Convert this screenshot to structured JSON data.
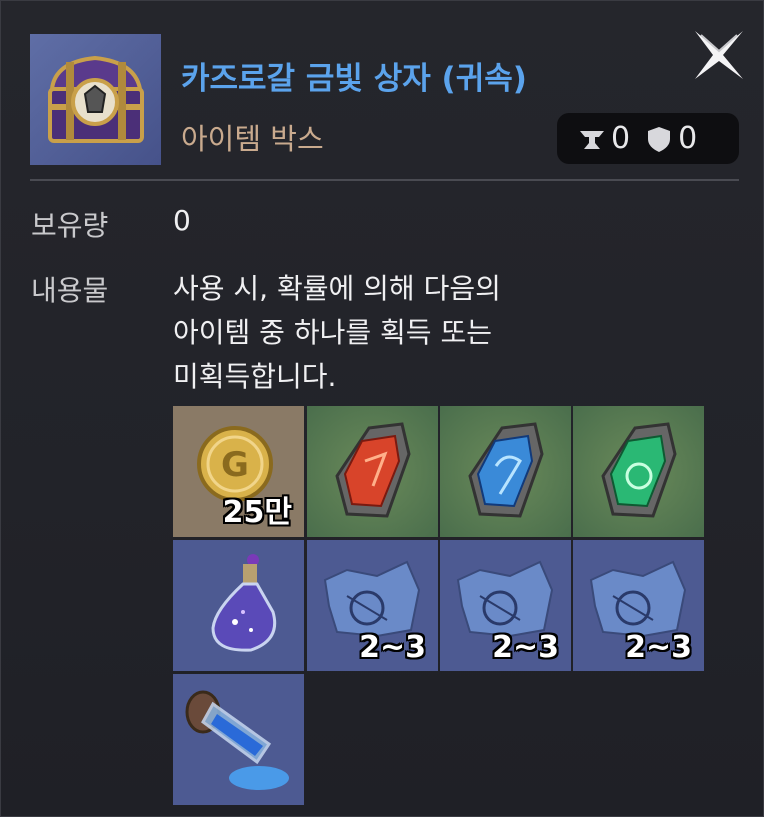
{
  "item": {
    "name": "카즈로갈 금빛 상자 (귀속)",
    "type": "아이템 박스",
    "icon": "treasure-chest-icon"
  },
  "counters": [
    {
      "icon": "anvil-icon",
      "value": "0"
    },
    {
      "icon": "shield-icon",
      "value": "0"
    }
  ],
  "stats": {
    "owned_label": "보유량",
    "owned_value": "0",
    "contents_label": "내용물",
    "contents_desc": "사용 시, 확률에 의해 다음의\n아이템 중 하나를 획득 또는\n미획득합니다."
  },
  "rewards": [
    {
      "icon": "gold-coin-icon",
      "qty": "25만",
      "bg": "#8a7a66"
    },
    {
      "icon": "red-crystal-icon",
      "qty": "",
      "bg": "#4e7a52"
    },
    {
      "icon": "blue-crystal-icon",
      "qty": "",
      "bg": "#4e7a52"
    },
    {
      "icon": "green-crystal-icon",
      "qty": "",
      "bg": "#4e7a52"
    },
    {
      "icon": "potion-flask-icon",
      "qty": "",
      "bg": "#4d5a92"
    },
    {
      "icon": "blueprint-scroll-icon",
      "qty": "2~3",
      "bg": "#4d5a92"
    },
    {
      "icon": "blueprint-scroll-icon",
      "qty": "2~3",
      "bg": "#4d5a92"
    },
    {
      "icon": "blueprint-scroll-icon",
      "qty": "2~3",
      "bg": "#4d5a92"
    },
    {
      "icon": "powder-vial-icon",
      "qty": "",
      "bg": "#4d5a92"
    }
  ]
}
